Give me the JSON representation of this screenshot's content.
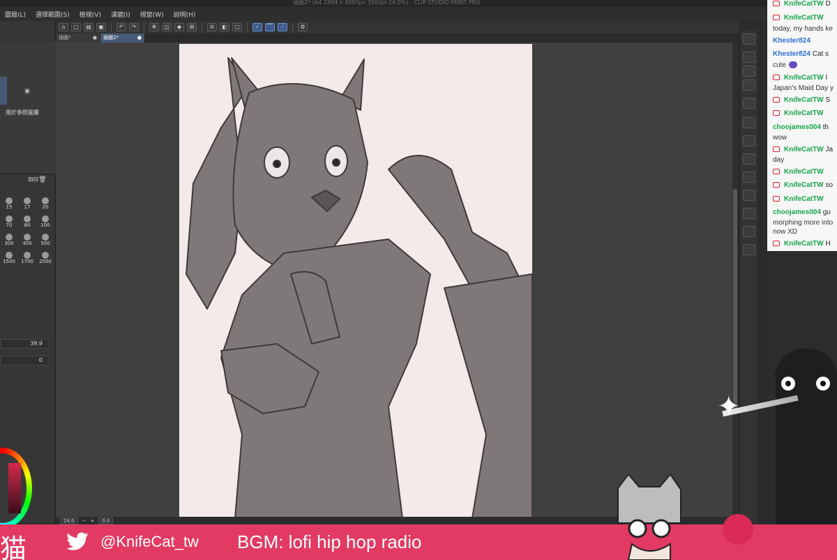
{
  "window": {
    "title": "插圖2* (A4 2894 x 4093px 350dpi 24.0%) - CLIP STUDIO PAINT PRO"
  },
  "menu": {
    "items": [
      "圖層(L)",
      "選擇範圍(S)",
      "檢視(V)",
      "濾鏡(I)",
      "視窗(W)",
      "說明(H)"
    ]
  },
  "tabs": [
    {
      "label": "插圖*"
    },
    {
      "label": "插圖2*"
    }
  ],
  "left_panel": {
    "reference_label": "用於參照圖層",
    "brush_sizes": [
      "15",
      "17",
      "20",
      "70",
      "80",
      "100",
      "300",
      "400",
      "500",
      "1500",
      "1700",
      "2000"
    ],
    "opacity_value": "39.9",
    "angle_value": "0"
  },
  "statusbar": {
    "zoom": "24.0",
    "rotation": "0.0"
  },
  "chat": {
    "messages": [
      {
        "user": "KnifeCatTW",
        "text": "D",
        "color": "green"
      },
      {
        "user": "KnifeCatTW",
        "text": "",
        "color": "green"
      },
      {
        "user": "",
        "text": "today, my hands ke",
        "color": ""
      },
      {
        "user": "Khester824",
        "text": "",
        "color": "blue"
      },
      {
        "user": "Khester824",
        "text": "Cat s",
        "color": "blue"
      },
      {
        "user": "",
        "text": "cute",
        "color": ""
      },
      {
        "user": "KnifeCatTW",
        "text": "I",
        "color": "green"
      },
      {
        "user": "",
        "text": "Japan's Maid Day y",
        "color": ""
      },
      {
        "user": "KnifeCatTW",
        "text": "S",
        "color": "green"
      },
      {
        "user": "KnifeCatTW",
        "text": "",
        "color": "green"
      },
      {
        "user": "choojames004",
        "text": "th",
        "color": "green"
      },
      {
        "user": "",
        "text": "wow",
        "color": ""
      },
      {
        "user": "KnifeCatTW",
        "text": "Ja",
        "color": "green"
      },
      {
        "user": "",
        "text": "day",
        "color": ""
      },
      {
        "user": "KnifeCatTW",
        "text": "",
        "color": "green"
      },
      {
        "user": "KnifeCatTW",
        "text": "so",
        "color": "green"
      },
      {
        "user": "KnifeCatTW",
        "text": "",
        "color": "green"
      },
      {
        "user": "choojames004",
        "text": "gu",
        "color": "green"
      },
      {
        "user": "",
        "text": "morphing more into",
        "color": ""
      },
      {
        "user": "",
        "text": "now XD",
        "color": ""
      },
      {
        "user": "KnifeCatTW",
        "text": "H",
        "color": "green"
      }
    ]
  },
  "banner": {
    "logo": "猫",
    "handle": "@KnifeCat_tw",
    "bgm": "BGM: lofi hip hop radio"
  },
  "colors": {
    "banner_bg": "#e23a63",
    "canvas_bg": "#f3ebea",
    "chat_green": "#17a54a",
    "chat_blue": "#2a6dd6"
  }
}
